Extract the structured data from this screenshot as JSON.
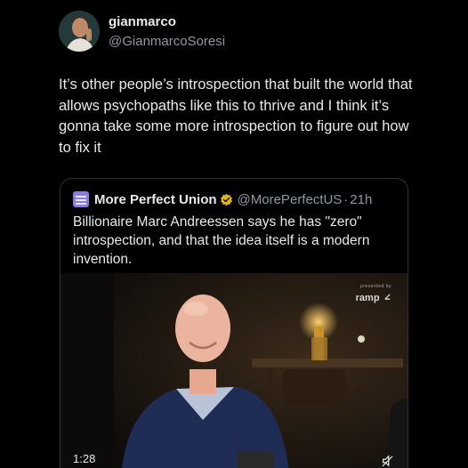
{
  "author": {
    "name": "gianmarco",
    "handle": "@GianmarcoSoresi"
  },
  "tweet": {
    "text": "It’s other people’s introspection that built the world that allows psychopaths like this to thrive and I think it’s gonna take some more introspection to figure out how to fix it"
  },
  "quote": {
    "name": "More Perfect Union",
    "handle": "@MorePerfectUS",
    "separator": "·",
    "time": "21h",
    "text": "Billionaire Marc Andreessen says he has \"zero\" introspection, and that the idea itself is a modern invention.",
    "video": {
      "duration": "1:28",
      "sponsor_caption": "presented by",
      "sponsor": "ramp"
    }
  },
  "colors": {
    "background": "#000000",
    "primary_text": "#e7e9ea",
    "secondary_text": "#8b98a5",
    "verified_gold": "#e2b719",
    "border": "#2f3336"
  },
  "icons": {
    "verified": "verified-badge-icon",
    "mute": "mute-icon",
    "logo": "ramp-logo-icon"
  }
}
